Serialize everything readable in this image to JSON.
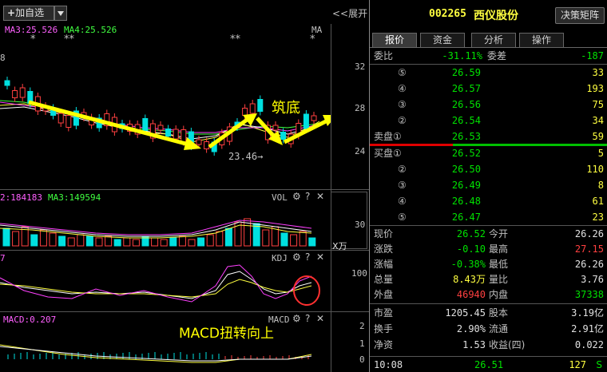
{
  "toolbar": {
    "add_watch_label": "加自选",
    "expand_label": "展开",
    "chevron_glyph": "<<"
  },
  "main_chart": {
    "ma3_label": "MA3:25.526",
    "ma4_label": "MA4:25.526",
    "ma_tag": "MA",
    "marks_row": [
      "*",
      "**",
      "**",
      "*"
    ],
    "left_edge_number": "8",
    "y_ticks": [
      "32",
      "28",
      "24"
    ],
    "low_annotation": "23.46",
    "annotation_text": "筑底"
  },
  "vol_panel": {
    "left_label": "2:184183",
    "ma3_label": "MA3:149594",
    "title": "VOL",
    "y_tick": "30",
    "unit": "X万"
  },
  "kdj_panel": {
    "left_label": "7",
    "title": "KDJ",
    "y_tick": "100"
  },
  "macd_panel": {
    "left_label": "MACD:0.207",
    "title": "MACD",
    "y_ticks": [
      "2",
      "1",
      "0"
    ],
    "annotation_text": "MACD扭转向上"
  },
  "stock": {
    "code": "002265",
    "name": "西仪股份",
    "decision_button": "决策矩阵"
  },
  "tabs": [
    "报价",
    "资金",
    "分析",
    "操作"
  ],
  "ratio_row": {
    "label1": "委比",
    "value1": "-31.11%",
    "label2": "委差",
    "value2": "-187"
  },
  "sell_orders": [
    {
      "label": "⑤",
      "price": "26.59",
      "volume": "33"
    },
    {
      "label": "④",
      "price": "26.57",
      "volume": "193"
    },
    {
      "label": "③",
      "price": "26.56",
      "volume": "75"
    },
    {
      "label": "②",
      "price": "26.54",
      "volume": "34"
    },
    {
      "label": "卖盘①",
      "price": "26.53",
      "volume": "59"
    }
  ],
  "buy_orders": [
    {
      "label": "买盘①",
      "price": "26.52",
      "volume": "5"
    },
    {
      "label": "②",
      "price": "26.50",
      "volume": "110"
    },
    {
      "label": "③",
      "price": "26.49",
      "volume": "8"
    },
    {
      "label": "④",
      "price": "26.48",
      "volume": "61"
    },
    {
      "label": "⑤",
      "price": "26.47",
      "volume": "23"
    }
  ],
  "stats": [
    {
      "l1": "现价",
      "v1": "26.52",
      "l2": "今开",
      "v2": "26.26"
    },
    {
      "l1": "涨跌",
      "v1": "-0.10",
      "l2": "最高",
      "v2": "27.15"
    },
    {
      "l1": "涨幅",
      "v1": "-0.38%",
      "l2": "最低",
      "v2": "26.26"
    },
    {
      "l1": "总量",
      "v1": "8.43万",
      "l2": "量比",
      "v2": "3.76"
    },
    {
      "l1": "外盘",
      "v1": "46940",
      "l2": "内盘",
      "v2": "37338"
    }
  ],
  "fundamentals": [
    {
      "l1": "市盈",
      "v1": "1205.45",
      "l2": "股本",
      "v2": "3.19亿"
    },
    {
      "l1": "换手",
      "v1": "2.90%",
      "l2": "流通",
      "v2": "2.91亿"
    },
    {
      "l1": "净资",
      "v1": "1.53",
      "l2": "收益(四)",
      "v2": "0.022"
    }
  ],
  "tick": {
    "time": "10:08",
    "price": "26.51",
    "volume": "127",
    "side": "S"
  },
  "colors": {
    "up": "#ff4040",
    "down": "#00e0e0",
    "ma_white": "#ffffff",
    "ma_yellow": "#ffff40",
    "ma_green": "#40ff40",
    "ma_magenta": "#ff40ff",
    "arrow": "#ffff00"
  }
}
